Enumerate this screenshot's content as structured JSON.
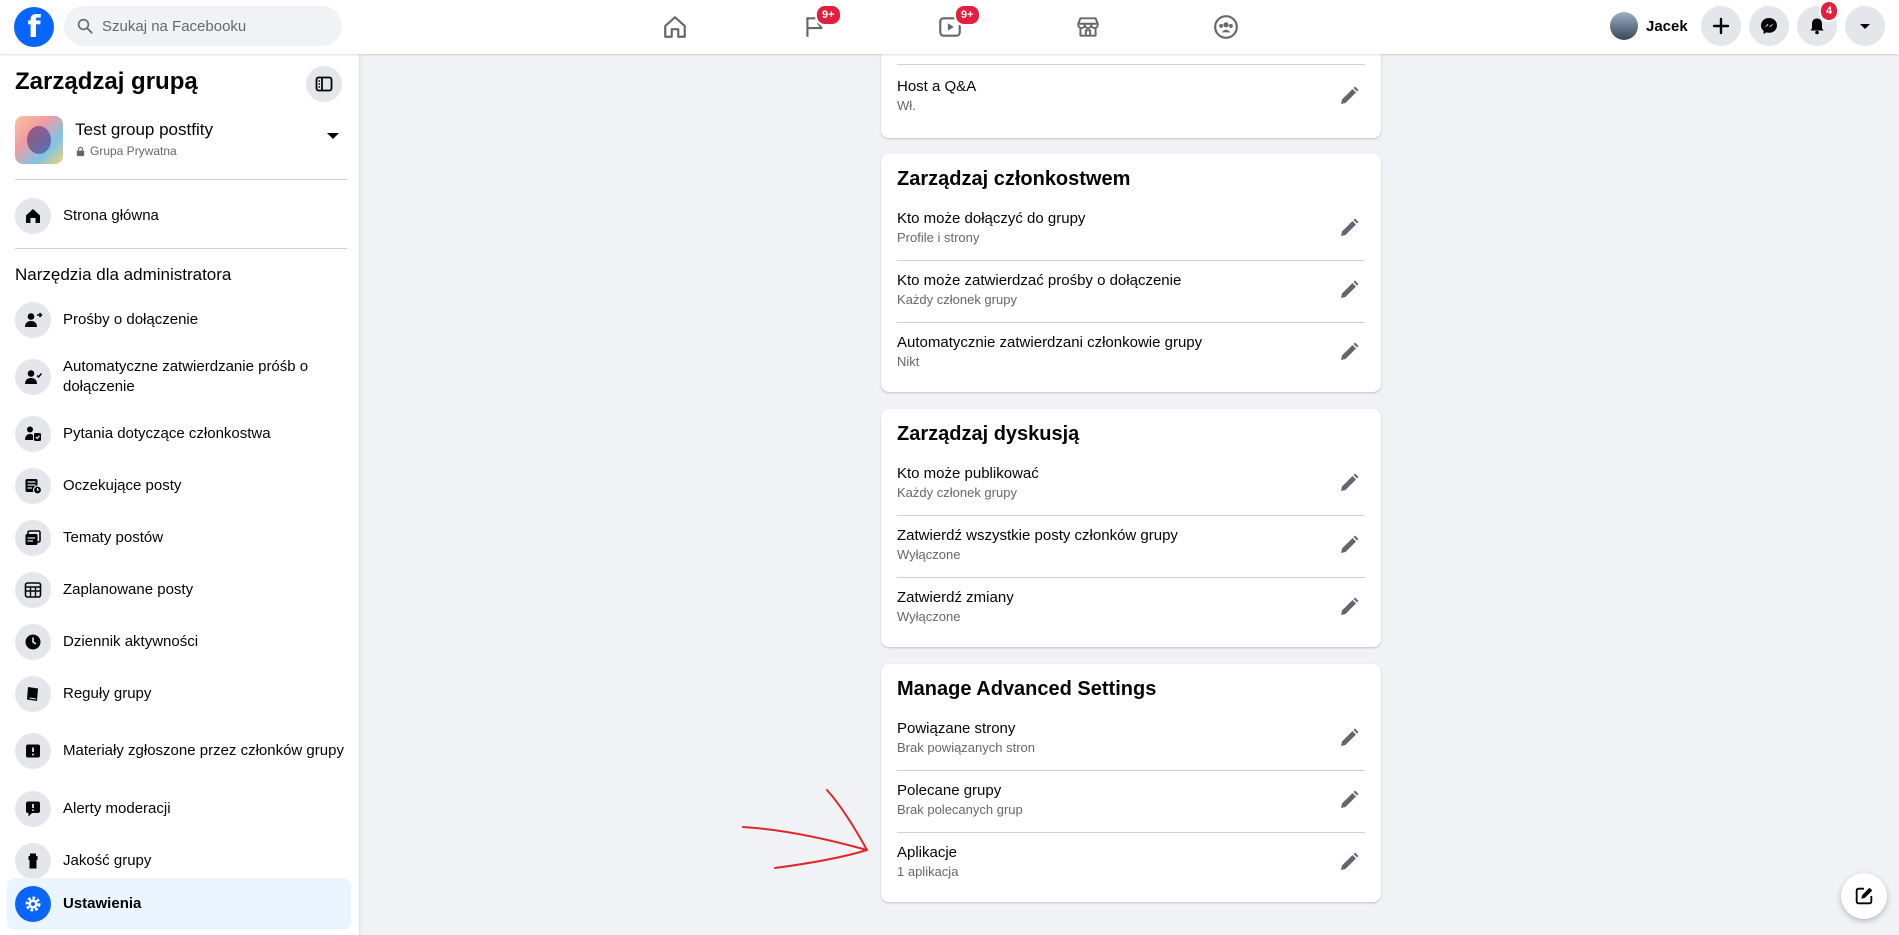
{
  "topbar": {
    "logo": "f",
    "search_placeholder": "Szukaj na Facebooku",
    "nav": [
      {
        "icon": "home-icon"
      },
      {
        "icon": "flag-icon",
        "badge": "9+"
      },
      {
        "icon": "video-icon",
        "badge": "9+"
      },
      {
        "icon": "marketplace-icon"
      },
      {
        "icon": "groups-icon"
      }
    ],
    "profile_name": "Jacek",
    "notifications_badge": "4"
  },
  "sidebar": {
    "title": "Zarządzaj grupą",
    "group_name": "Test group postfity",
    "group_privacy": "Grupa Prywatna",
    "home_label": "Strona główna",
    "admin_heading": "Narzędzia dla administratora",
    "items": [
      {
        "label": "Prośby o dołączenie",
        "icon": "person-arrow-icon"
      },
      {
        "label": "Automatyczne zatwierdzanie próśb o dołączenie",
        "icon": "person-check-icon"
      },
      {
        "label": "Pytania dotyczące członkostwa",
        "icon": "person-question-icon"
      },
      {
        "label": "Oczekujące posty",
        "icon": "pending-posts-icon"
      },
      {
        "label": "Tematy postów",
        "icon": "post-topics-icon"
      },
      {
        "label": "Zaplanowane posty",
        "icon": "calendar-icon"
      },
      {
        "label": "Dziennik aktywności",
        "icon": "clock-icon"
      },
      {
        "label": "Reguły grupy",
        "icon": "rules-book-icon"
      },
      {
        "label": "Materiały zgłoszone przez członków grupy",
        "icon": "report-icon"
      },
      {
        "label": "Alerty moderacji",
        "icon": "alert-bubble-icon"
      },
      {
        "label": "Jakość grupy",
        "icon": "quality-icon"
      },
      {
        "label": "Ustawienia",
        "icon": "gear-icon"
      }
    ]
  },
  "cards": {
    "top": {
      "rows": [
        {
          "title": "Host a Q&A",
          "sub": "Wł."
        }
      ]
    },
    "membership": {
      "title": "Zarządzaj członkostwem",
      "rows": [
        {
          "title": "Kto może dołączyć do grupy",
          "sub": "Profile i strony"
        },
        {
          "title": "Kto może zatwierdzać prośby o dołączenie",
          "sub": "Każdy członek grupy"
        },
        {
          "title": "Automatycznie zatwierdzani członkowie grupy",
          "sub": "Nikt"
        }
      ]
    },
    "discussion": {
      "title": "Zarządzaj dyskusją",
      "rows": [
        {
          "title": "Kto może publikować",
          "sub": "Każdy członek grupy"
        },
        {
          "title": "Zatwierdź wszystkie posty członków grupy",
          "sub": "Wyłączone"
        },
        {
          "title": "Zatwierdź zmiany",
          "sub": "Wyłączone"
        }
      ]
    },
    "advanced": {
      "title": "Manage Advanced Settings",
      "rows": [
        {
          "title": "Powiązane strony",
          "sub": "Brak powiązanych stron"
        },
        {
          "title": "Polecane grupy",
          "sub": "Brak polecanych grup"
        },
        {
          "title": "Aplikacje",
          "sub": "1 aplikacja"
        }
      ]
    }
  },
  "colors": {
    "brand": "#0866ff",
    "badge": "#e41e3f",
    "annotation": "#e0262a"
  }
}
